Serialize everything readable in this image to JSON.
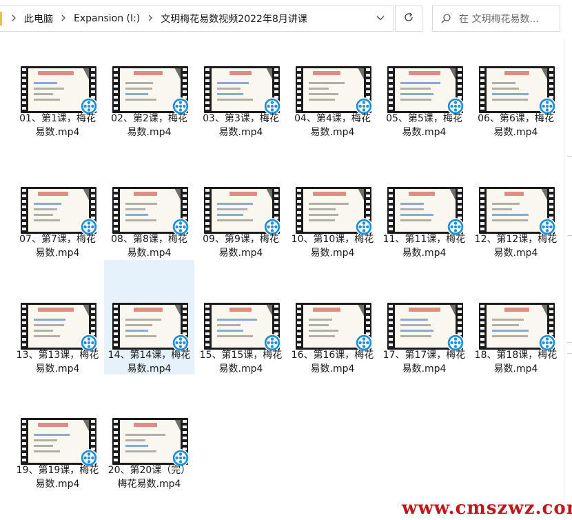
{
  "address_bar": {
    "crumbs": [
      "此电脑",
      "Expansion (I:)",
      "文玥梅花易数视频2022年8月讲课"
    ]
  },
  "search": {
    "placeholder": "在 文玥梅花易数..."
  },
  "files": [
    {
      "name": "01、第1课，梅花易数.mp4",
      "selected": false
    },
    {
      "name": "02、第2课，梅花易数.mp4",
      "selected": false
    },
    {
      "name": "03、第3课，梅花易数.mp4",
      "selected": false
    },
    {
      "name": "04、第4课，梅花易数.mp4",
      "selected": false
    },
    {
      "name": "05、第5课，梅花易数.mp4",
      "selected": false
    },
    {
      "name": "06、第6课，梅花易数.mp4",
      "selected": false
    },
    {
      "name": "07、第7课，梅花易数.mp4",
      "selected": false
    },
    {
      "name": "08、第8课，梅花易数.mp4",
      "selected": false
    },
    {
      "name": "09、第9课，梅花易数.mp4",
      "selected": false
    },
    {
      "name": "10、第10课，梅花易数.mp4",
      "selected": false
    },
    {
      "name": "11、第11课，梅花易数.mp4",
      "selected": false
    },
    {
      "name": "12、第12课，梅花易数.mp4",
      "selected": false
    },
    {
      "name": "13、第13课，梅花易数.mp4",
      "selected": false
    },
    {
      "name": "14、第14课，梅花易数.mp4",
      "selected": true
    },
    {
      "name": "15、第15课，梅花易数.mp4",
      "selected": false
    },
    {
      "name": "16、第16课，梅花易数.mp4",
      "selected": false
    },
    {
      "name": "17、第17课，梅花易数.mp4",
      "selected": false
    },
    {
      "name": "18、第18课，梅花易数.mp4",
      "selected": false
    },
    {
      "name": "19、第19课，梅花易数.mp4",
      "selected": false
    },
    {
      "name": "20、第20课（完）梅花易数.mp4",
      "selected": false
    }
  ],
  "watermark": "www.cmszwz.com",
  "colors": {
    "selection": "#e5f1fb",
    "badge": "#1e8fd8",
    "watermark": "#c0171d"
  },
  "icons": {
    "refresh": "refresh-icon",
    "search": "search-icon",
    "chevron": "chevron-right-icon",
    "dropdown": "chevron-down-icon",
    "video_badge": "video-reel-icon"
  }
}
